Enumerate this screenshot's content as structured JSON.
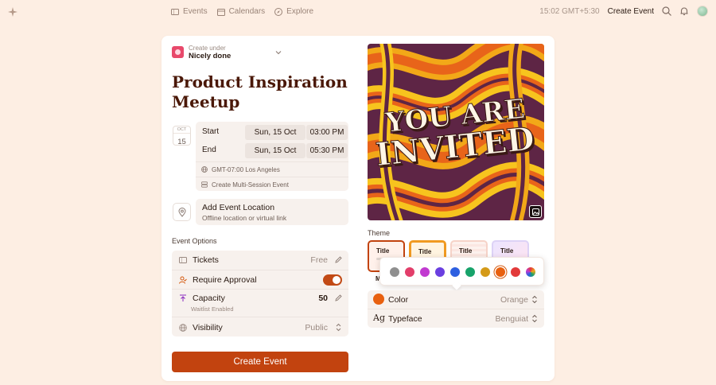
{
  "topbar": {
    "nav": [
      "Events",
      "Calendars",
      "Explore"
    ],
    "time": "15:02 GMT+5:30",
    "create_label": "Create Event"
  },
  "creator": {
    "sub": "Create under",
    "name": "Nicely done"
  },
  "event": {
    "title": "Product Inspiration Meetup",
    "date_badge": {
      "month": "OCT",
      "day": "15"
    },
    "start": {
      "label": "Start",
      "date": "Sun, 15 Oct",
      "time": "03:00 PM"
    },
    "end": {
      "label": "End",
      "date": "Sun, 15 Oct",
      "time": "05:30 PM"
    },
    "timezone": "GMT-07:00 Los Angeles",
    "multi_session": "Create Multi-Session Event",
    "location": {
      "title": "Add Event Location",
      "sub": "Offline location or virtual link"
    }
  },
  "options": {
    "heading": "Event Options",
    "tickets": {
      "label": "Tickets",
      "value": "Free"
    },
    "approval": {
      "label": "Require Approval",
      "on": true
    },
    "capacity": {
      "label": "Capacity",
      "value": "50",
      "sub": "Waitlist Enabled"
    },
    "visibility": {
      "label": "Visibility",
      "value": "Public"
    }
  },
  "create_button": "Create Event",
  "poster": {
    "line1": "YOU ARE",
    "line2": "INVITED"
  },
  "theme": {
    "heading": "Theme",
    "options": [
      "Title",
      "Title",
      "Title",
      "Title"
    ],
    "selected_label_fragment": "M",
    "swatches": [
      "#8f8f8f",
      "#e23e6a",
      "#c13ad0",
      "#6a3fe0",
      "#2d5fe0",
      "#17a36a",
      "#d49a18",
      "#e8600f",
      "#e23a3a",
      "rainbow"
    ],
    "selected_swatch": 7
  },
  "properties": {
    "color": {
      "label": "Color",
      "value": "Orange",
      "hex": "#e8600f"
    },
    "typeface": {
      "label": "Typeface",
      "value": "Benguiat",
      "icon_text": "Ag"
    }
  },
  "colors": {
    "accent": "#c2430f",
    "page_bg": "#fdeee3",
    "title": "#4a1808"
  }
}
